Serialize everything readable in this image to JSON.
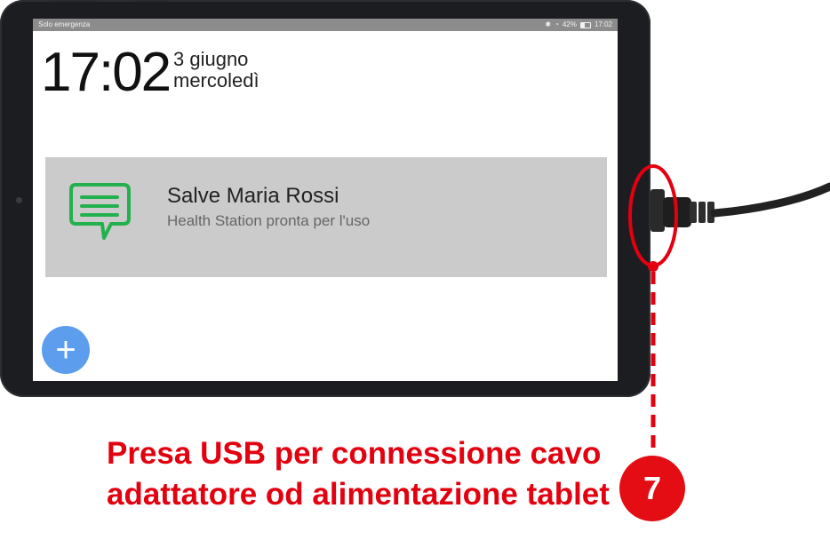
{
  "status_bar": {
    "left_text": "Solo emergenza",
    "battery": "42%",
    "time": "17:02"
  },
  "lock_screen": {
    "clock": "17:02",
    "date_line1": "3 giugno",
    "date_line2": "mercoledì"
  },
  "notification": {
    "icon": "message-icon",
    "title": "Salve Maria Rossi",
    "subtitle": "Health Station pronta per l'uso"
  },
  "fab": {
    "icon": "plus-icon",
    "label": "+"
  },
  "annotation": {
    "caption_line1": "Presa USB per connessione cavo",
    "caption_line2": "adattatore od alimentazione tablet",
    "callout_number": "7",
    "color": "#e3000f"
  },
  "colors": {
    "card_background": "#cbcbcb",
    "fab": "#5c9ded",
    "message_icon": "#22b14c",
    "status_bar": "#8c8c8c"
  }
}
